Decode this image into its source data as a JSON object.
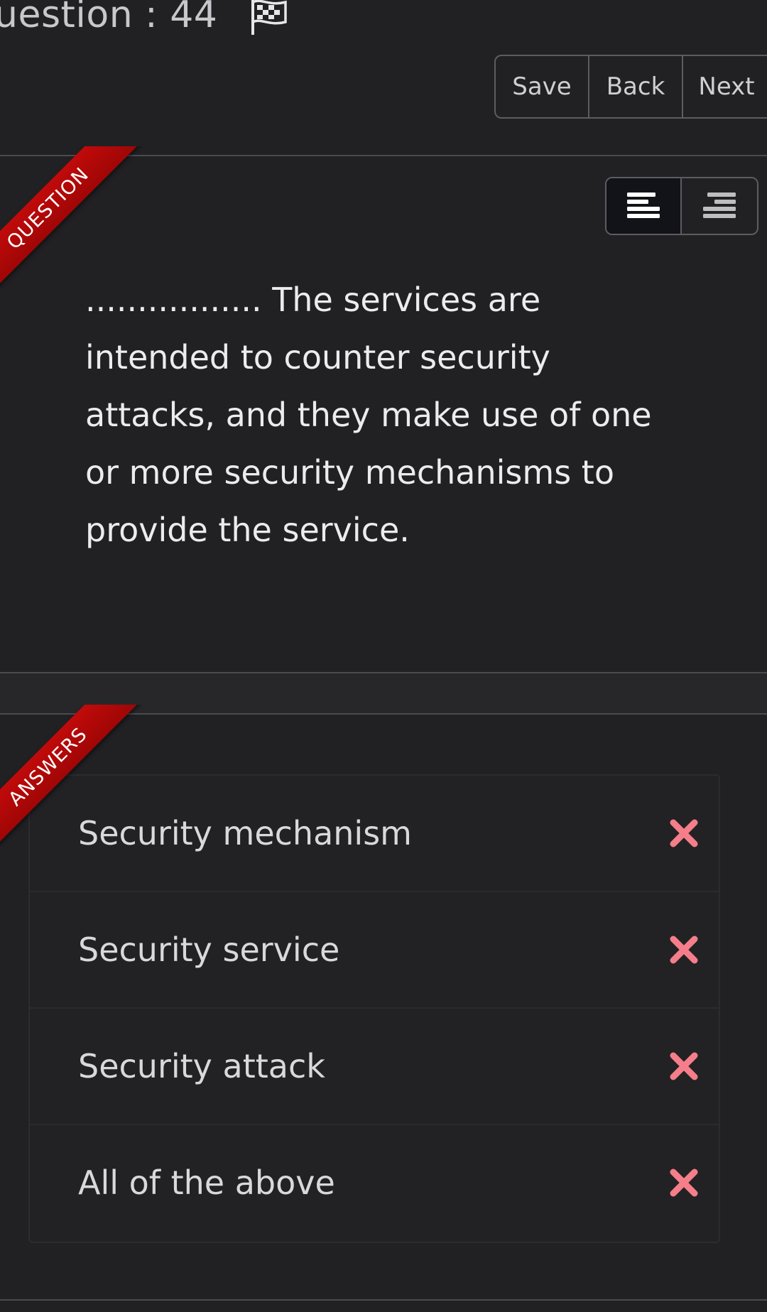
{
  "header": {
    "title": "uestion : 44",
    "flag_icon": "checkered-flag-icon"
  },
  "toolbar": {
    "save_label": "Save",
    "back_label": "Back",
    "next_label": "Next"
  },
  "question": {
    "ribbon_label": "QUESTION",
    "text": "................. The services are intended to counter security attacks, and they make use of one or more security mechanisms to provide the service.",
    "align_buttons": [
      "align-left-icon",
      "align-right-icon"
    ]
  },
  "answers": {
    "ribbon_label": "ANSWERS",
    "items": [
      {
        "label": "Security mechanism",
        "status_icon": "wrong-x-icon"
      },
      {
        "label": "Security service",
        "status_icon": "wrong-x-icon"
      },
      {
        "label": "Security attack",
        "status_icon": "wrong-x-icon"
      },
      {
        "label": "All of the above",
        "status_icon": "wrong-x-icon"
      }
    ]
  },
  "colors": {
    "background": "#212123",
    "ribbon": "#b80808",
    "wrong_icon": "#f57e8a",
    "border": "#5c5c62"
  }
}
